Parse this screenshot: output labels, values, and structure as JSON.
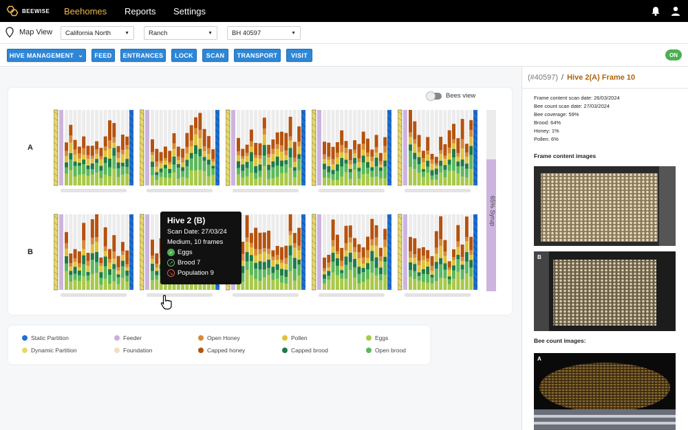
{
  "brand": {
    "name": "BEEWISE",
    "accent": "#f2b84b"
  },
  "nav": {
    "items": [
      "Beehomes",
      "Reports",
      "Settings"
    ],
    "active": "Beehomes"
  },
  "header_icons": [
    "bell-icon",
    "user-icon"
  ],
  "filters": {
    "map_view_label": "Map View",
    "region": "California North",
    "site": "Ranch",
    "beehome": "BH 40597"
  },
  "actions": {
    "hive_management": "HIVE MANAGEMENT",
    "feed": "FEED",
    "entrances": "ENTRANCES",
    "lock": "LOCK",
    "scan": "SCAN",
    "transport": "TRANSPORT",
    "visit": "VISIT",
    "status": "ON"
  },
  "hive_view": {
    "bees_view_label": "Bees view",
    "rows": [
      "A",
      "B"
    ],
    "syrup_label": "65% Syrup",
    "syrup_percent": 65
  },
  "tooltip": {
    "title": "Hive 2 (B)",
    "scan_date": "Scan Date: 27/03/24",
    "size": "Medium, 10 frames",
    "eggs": "Eggs",
    "brood": "Brood  7",
    "population": "Population 9"
  },
  "legend": [
    {
      "label": "Static Partition",
      "color": "#1f6fd0"
    },
    {
      "label": "Feeder",
      "color": "#c9b1dc"
    },
    {
      "label": "Open Honey",
      "color": "#d58a3a"
    },
    {
      "label": "Pollen",
      "color": "#e0c23a"
    },
    {
      "label": "Eggs",
      "color": "#a8c94a"
    },
    {
      "label": "Dynamic Partition",
      "color": "#e8d86a"
    },
    {
      "label": "Foundation",
      "color": "#f1dfb8"
    },
    {
      "label": "Capped honey",
      "color": "#b5520f"
    },
    {
      "label": "Capped brood",
      "color": "#1e7a4a"
    },
    {
      "label": "Open brood",
      "color": "#5cb85c"
    }
  ],
  "right_panel": {
    "breadcrumb_id": "(#40597)",
    "breadcrumb_sep": "/",
    "breadcrumb_frame": "Hive 2(A) Frame 10",
    "stats": [
      "Frame content scan date: 26/03/2024",
      "Bee count scan date: 27/03/2024",
      "Bee coverage: 59%",
      "Brood: 64%",
      "Honey: 1%",
      "Pollen: 6%"
    ],
    "frame_content_title": "Frame content images",
    "bee_count_title": "Bee count images:",
    "image_tags": [
      "B",
      "A"
    ]
  }
}
